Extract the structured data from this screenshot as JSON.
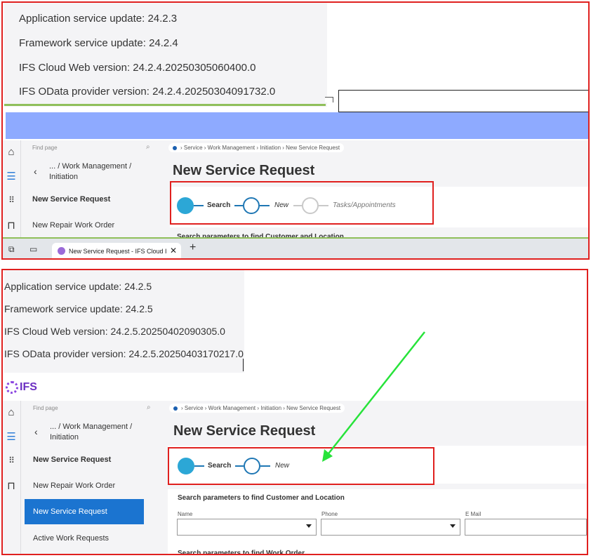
{
  "before": {
    "versions": [
      "Application service update: 24.2.3",
      "Framework service update: 24.2.4",
      "IFS Cloud Web version: 24.2.4.20250305060400.0",
      "IFS OData provider version: 24.2.4.20250304091732.0"
    ],
    "nav": {
      "find_placeholder": "Find page",
      "crumb_path": "... / Work Management / Initiation",
      "items": [
        "New Service Request",
        "New Repair Work Order"
      ]
    },
    "breadcrumb": "›  Service  ›  Work Management  ›  Initiation  ›  New Service Request",
    "page_title": "New Service Request",
    "steps": [
      "Search",
      "New",
      "Tasks/Appointments"
    ],
    "section_title": "Search parameters to find Customer and Location",
    "browser_tab": {
      "title": "New Service Request - IFS Cloud I"
    }
  },
  "after": {
    "versions": [
      "Application service update: 24.2.5",
      "Framework service update: 24.2.5",
      "IFS Cloud Web version: 24.2.5.20250402090305.0",
      "IFS OData provider version: 24.2.5.20250403170217.0"
    ],
    "logo_text": "IFS",
    "nav": {
      "find_placeholder": "Find page",
      "crumb_path": "... / Work Management / Initiation",
      "items": [
        "New Service Request",
        "New Repair Work Order",
        "New Service Request",
        "Active Work Requests"
      ]
    },
    "breadcrumb": "›  Service  ›  Work Management  ›  Initiation  ›  New Service Request",
    "page_title": "New Service Request",
    "steps": [
      "Search",
      "New"
    ],
    "section_title": "Search parameters to find Customer and Location",
    "fields": [
      "Name",
      "Phone",
      "E Mail"
    ],
    "section_title_2": "Search parameters to find Work Order"
  },
  "colors": {
    "highlight_red": "#e0201f",
    "accent_blue": "#1b74d0",
    "step_blue": "#2ca7d6",
    "arrow_green": "#27e33a",
    "ifs_purple": "#6b2fc2"
  }
}
